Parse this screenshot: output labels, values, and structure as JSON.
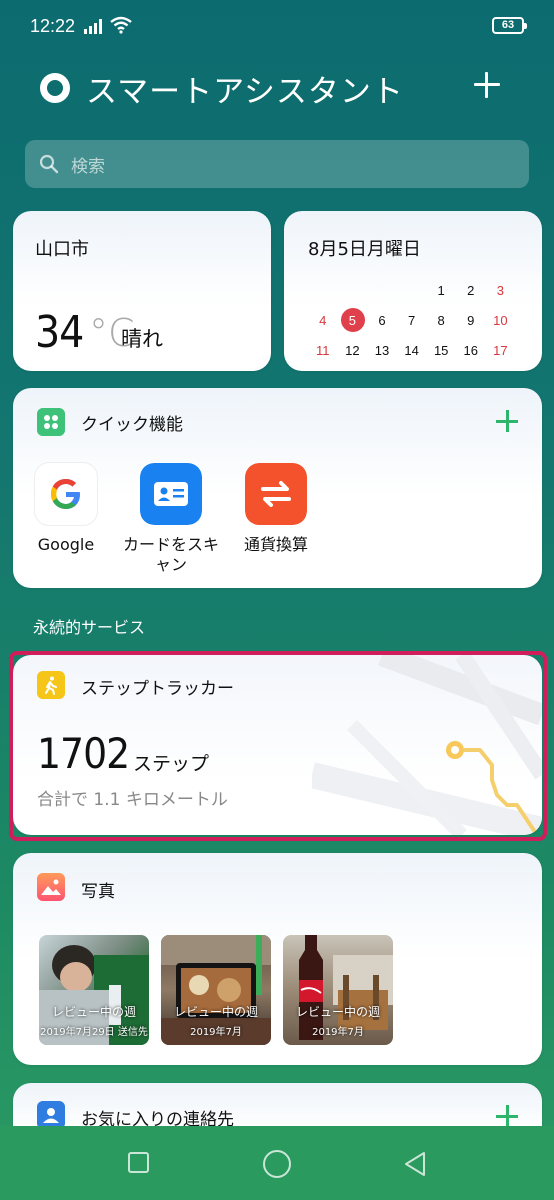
{
  "status": {
    "time": "12:22",
    "battery": "63"
  },
  "header": {
    "title": "スマートアシスタント"
  },
  "search": {
    "placeholder": "検索"
  },
  "weather": {
    "city": "山口市",
    "temperature": "34",
    "unit": "°C",
    "condition": "晴れ"
  },
  "calendar": {
    "date_label": "8月5日月曜日",
    "rows": [
      [
        "",
        "",
        "",
        "",
        "1",
        "2",
        "3"
      ],
      [
        "4",
        "5",
        "6",
        "7",
        "8",
        "9",
        "10"
      ],
      [
        "11",
        "12",
        "13",
        "14",
        "15",
        "16",
        "17"
      ]
    ],
    "today": "5"
  },
  "quick": {
    "title": "クイック機能",
    "items": [
      {
        "label": "Google",
        "icon": "google-icon"
      },
      {
        "label": "カードをスキャン",
        "icon": "card-scan-icon"
      },
      {
        "label": "通貨換算",
        "icon": "currency-exchange-icon"
      }
    ]
  },
  "section": {
    "persistent": "永続的サービス"
  },
  "step": {
    "title": "ステップトラッカー",
    "count": "1702",
    "unit": "ステップ",
    "distance": "合計で 1.1 キロメートル"
  },
  "photos": {
    "title": "写真",
    "items": [
      {
        "caption": "レビュー中の週",
        "date": "2019年7月29日 送信先"
      },
      {
        "caption": "レビュー中の週",
        "date": "2019年7月"
      },
      {
        "caption": "レビュー中の週",
        "date": "2019年7月"
      }
    ]
  },
  "contacts": {
    "title": "お気に入りの連絡先"
  },
  "colors": {
    "accent_green": "#2db56c",
    "highlight": "#d01e5a",
    "today_red": "#e0404b"
  }
}
